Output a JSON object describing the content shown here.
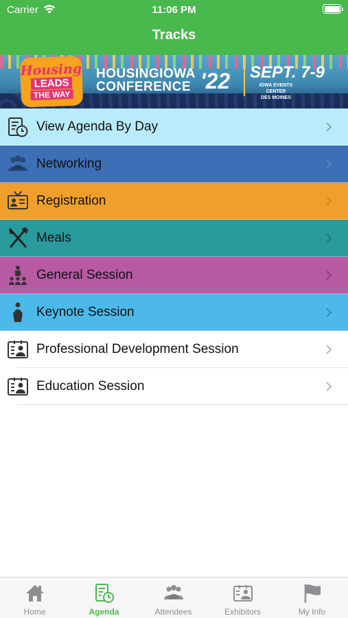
{
  "status": {
    "carrier": "Carrier",
    "time": "11:06 PM"
  },
  "nav": {
    "title": "Tracks"
  },
  "banner": {
    "badge_line1": "Housing",
    "badge_line2": "LEADS",
    "badge_line3": "THE WAY",
    "title_line1": "HOUSINGIOWA",
    "title_line2": "CONFERENCE",
    "year": "'22",
    "date": "SEPT. 7-9",
    "venue_line1": "IOWA EVENTS CENTER",
    "venue_line2": "DES MOINES"
  },
  "tracks": [
    {
      "label": "View Agenda By Day",
      "icon": "calendar-clock-icon",
      "bg": "#b9ecfb"
    },
    {
      "label": "Networking",
      "icon": "people-group-icon",
      "bg": "#3d6fb6"
    },
    {
      "label": "Registration",
      "icon": "id-badge-icon",
      "bg": "#f0a02a"
    },
    {
      "label": "Meals",
      "icon": "fork-knife-icon",
      "bg": "#2a9a9c"
    },
    {
      "label": "General Session",
      "icon": "audience-icon",
      "bg": "#b65aa3"
    },
    {
      "label": "Keynote Session",
      "icon": "podium-speaker-icon",
      "bg": "#4cb9e9"
    },
    {
      "label": "Professional Development Session",
      "icon": "contact-card-icon",
      "bg": "#ffffff"
    },
    {
      "label": "Education Session",
      "icon": "contact-card-icon",
      "bg": "#ffffff"
    }
  ],
  "tabs": [
    {
      "label": "Home",
      "icon": "home-icon",
      "active": false
    },
    {
      "label": "Agenda",
      "icon": "agenda-icon",
      "active": true
    },
    {
      "label": "Attendees",
      "icon": "attendees-icon",
      "active": false
    },
    {
      "label": "Exhibitors",
      "icon": "exhibitors-icon",
      "active": false
    },
    {
      "label": "My Info",
      "icon": "flag-icon",
      "active": false
    }
  ],
  "colors": {
    "brand_green": "#49b84d",
    "inactive_tab": "#8e8e93"
  }
}
